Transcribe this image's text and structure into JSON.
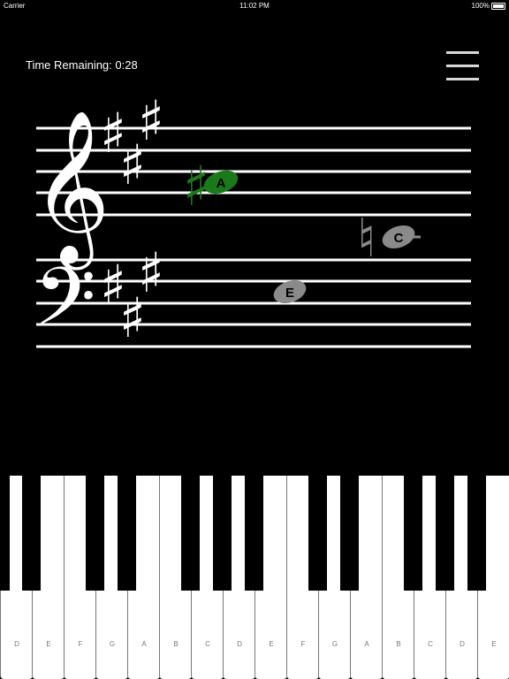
{
  "status_bar": {
    "carrier": "Carrier",
    "time": "11:02 PM",
    "battery": "100%"
  },
  "timer": {
    "text": "Time Remaining: 0:28"
  },
  "menu": {
    "icon": "hamburger-menu-icon"
  },
  "score": {
    "key_signature": "three sharps (F#, C#, G#)",
    "notes": [
      {
        "label": "A",
        "accidental": "sharp",
        "color": "#1a7a1a"
      },
      {
        "label": "C",
        "accidental": "natural",
        "color": "#8a8a8a"
      },
      {
        "label": "E",
        "accidental": "",
        "color": "#8a8a8a"
      }
    ]
  },
  "keyboard": {
    "white_keys": [
      "D",
      "E",
      "F",
      "G",
      "A",
      "B",
      "C",
      "D",
      "E",
      "F",
      "G",
      "A",
      "B",
      "C",
      "D",
      "E"
    ],
    "highlighted_black_key": "A#",
    "highlight_color": "#5a5a5a"
  }
}
